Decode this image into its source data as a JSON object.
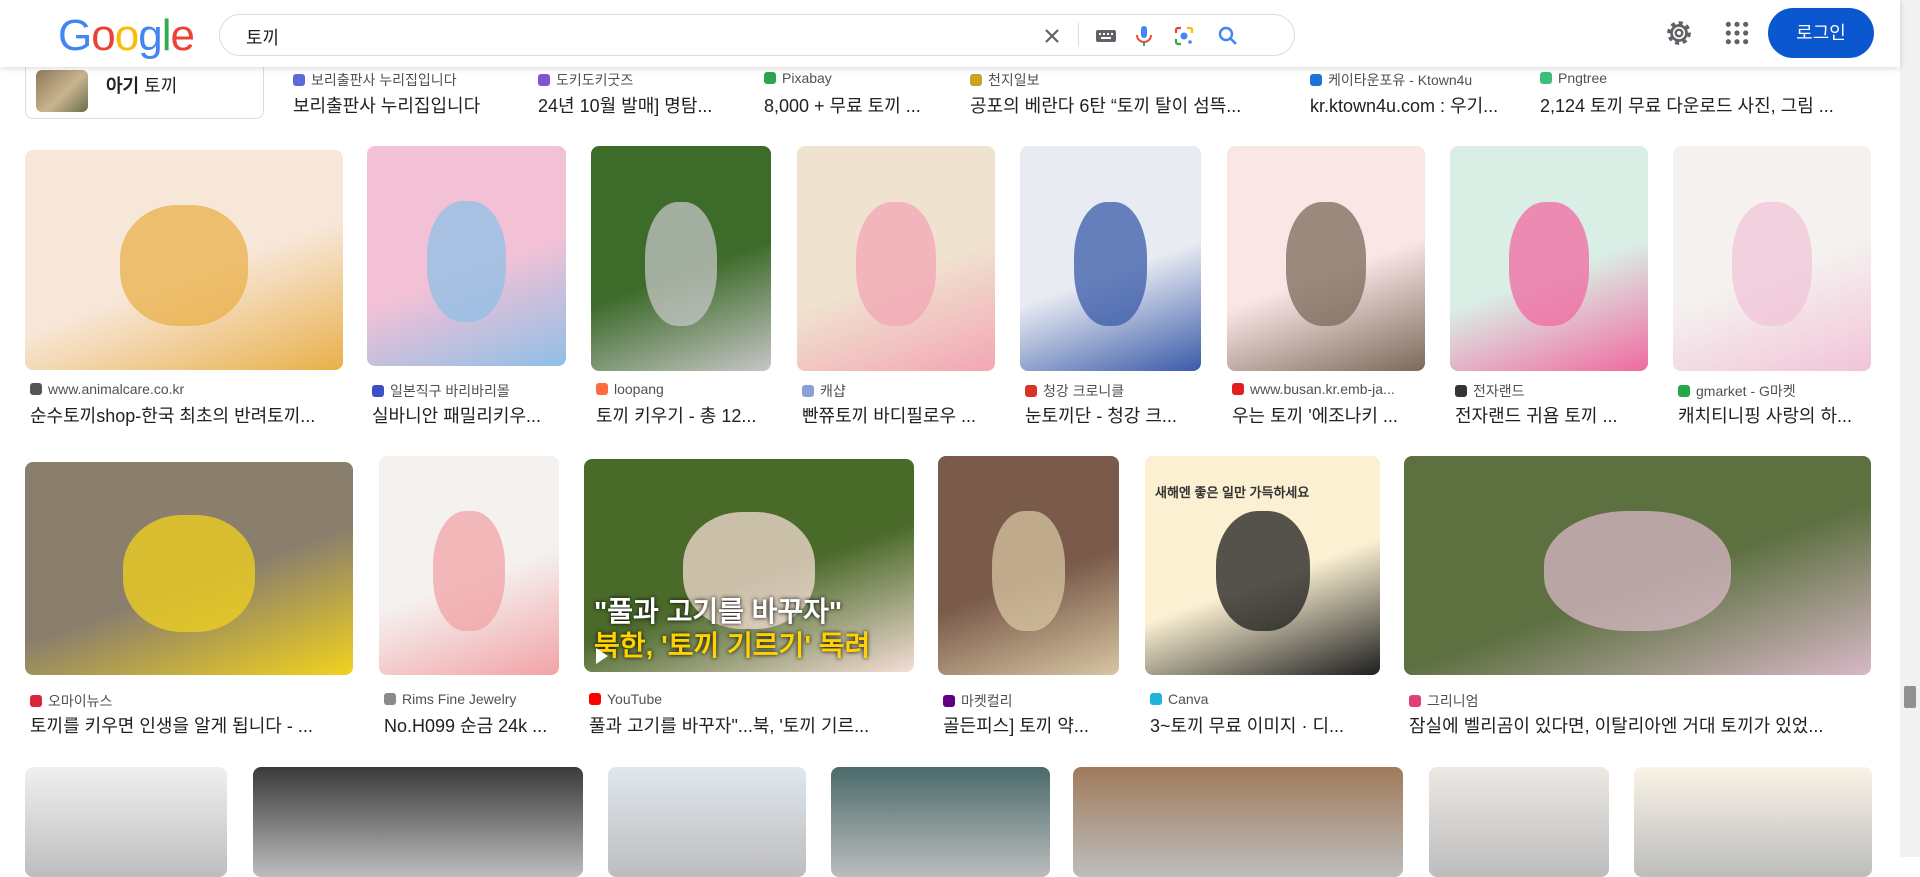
{
  "header": {
    "logo_letters": [
      {
        "ch": "G",
        "color": "#4285F4"
      },
      {
        "ch": "o",
        "color": "#EA4335"
      },
      {
        "ch": "o",
        "color": "#FBBC05"
      },
      {
        "ch": "g",
        "color": "#4285F4"
      },
      {
        "ch": "l",
        "color": "#34A853"
      },
      {
        "ch": "e",
        "color": "#EA4335"
      }
    ],
    "query": "토끼",
    "login_label": "로그인",
    "icons": [
      "clear-icon",
      "keyboard-icon",
      "mic-icon",
      "lens-icon",
      "search-icon",
      "settings-icon",
      "apps-icon"
    ]
  },
  "related": {
    "label_prefix": "아기",
    "label_main": "토끼"
  },
  "row0": [
    {
      "source": "보리출판사 누리집입니다",
      "title": "보리출판사 누리집입니다",
      "fav": "#5f6ad9"
    },
    {
      "source": "도키도키굿즈",
      "title": "24년 10월 발매] 명탐...",
      "fav": "#7b55d6"
    },
    {
      "source": "Pixabay",
      "title": "8,000 + 무료 토끼 ...",
      "fav": "#2ea44f"
    },
    {
      "source": "천지일보",
      "title": "공포의 베란다 6탄 “토끼 탈이 섬뜩...",
      "fav": "#c9a227"
    },
    {
      "source": "케이타운포유 - Ktown4u",
      "title": "kr.ktown4u.com : 우기...",
      "fav": "#1e73d8"
    },
    {
      "source": "Pngtree",
      "title": "2,124 토끼 무료 다운로드 사진, 그림 ...",
      "fav": "#3bbf7a"
    }
  ],
  "row1": [
    {
      "source": "www.animalcare.co.kr",
      "title": "순수토끼shop-한국 최초의 반려토끼...",
      "fav": "#555555",
      "color": "#f7e7d8",
      "accent": "#e9b04a"
    },
    {
      "source": "일본직구 바리바리몰",
      "title": "실바니안 패밀리키우...",
      "fav": "#3b4fc9",
      "color": "#f3c1d6",
      "accent": "#8fbfe6"
    },
    {
      "source": "loopang",
      "title": "토끼 키우기 - 총 12...",
      "fav": "#ff6b3d",
      "color": "#3d6b2a",
      "accent": "#c6c6c6"
    },
    {
      "source": "캐샵",
      "title": "빤쮸토끼 바디필로우 ...",
      "fav": "#8aa2d6",
      "color": "#efe3d0",
      "accent": "#f3a6b4"
    },
    {
      "source": "청강 크로니클",
      "title": "눈토끼단 - 청강 크...",
      "fav": "#d8352a",
      "color": "#e8ebf2",
      "accent": "#3a5ba8"
    },
    {
      "source": "www.busan.kr.emb-ja...",
      "title": "우는 토끼 '에조나키 ...",
      "fav": "#e02020",
      "color": "#fbe6e6",
      "accent": "#7a6a5a"
    },
    {
      "source": "전자랜드",
      "title": "전자랜드 귀욤 토끼 ...",
      "fav": "#333333",
      "color": "#d9efe6",
      "accent": "#f06aa0"
    },
    {
      "source": "gmarket - G마켓",
      "title": "캐치티니핑 사랑의 하...",
      "fav": "#27a844",
      "color": "#f4f1ef",
      "accent": "#f2c4d8"
    }
  ],
  "row2": [
    {
      "source": "오마이뉴스",
      "title": "토끼를 키우면 인생을 알게 됩니다 - ...",
      "fav": "#d8263a",
      "color": "#8a7f6d",
      "accent": "#f2d21d"
    },
    {
      "source": "Rims Fine Jewelry",
      "title": "No.H099 순금 24k ...",
      "fav": "#8a8a8a",
      "color": "#f4f1ef",
      "accent": "#f2a3a7"
    },
    {
      "source": "YouTube",
      "title": "풀과 고기를 바꾸자\"...북, '토끼 기르...",
      "fav": "#ff0000",
      "color": "#4a6a2a",
      "accent": "#f5ddd6",
      "overlay1": "\"풀과 고기를 바꾸자\"",
      "overlay2": "북한, '토끼 기르기' 독려"
    },
    {
      "source": "마켓컬리",
      "title": "골든피스] 토끼 약...",
      "fav": "#5f0080",
      "color": "#7a5a4a",
      "accent": "#d7c6a2"
    },
    {
      "source": "Canva",
      "title": "3~토끼 무료 이미지 · 디...",
      "fav": "#20b5d8",
      "color": "#fbf0d2",
      "accent": "#1e1e1e",
      "canva1": "새해엔 좋은 일만 가득하세요"
    },
    {
      "source": "그리니엄",
      "title": "잠실에 벨리곰이 있다면, 이탈리아엔 거대 토끼가 있었...",
      "fav": "#e0407a",
      "color": "#5c7040",
      "accent": "#d8b8c6"
    }
  ],
  "row3": [
    {
      "color": "#f0f0f0"
    },
    {
      "color": "#3a3a3a"
    },
    {
      "color": "#dfe7ee"
    },
    {
      "color": "#4a6a6a"
    },
    {
      "color": "#a07a5a"
    },
    {
      "color": "#ece8e4"
    },
    {
      "color": "#faf3e6"
    }
  ]
}
